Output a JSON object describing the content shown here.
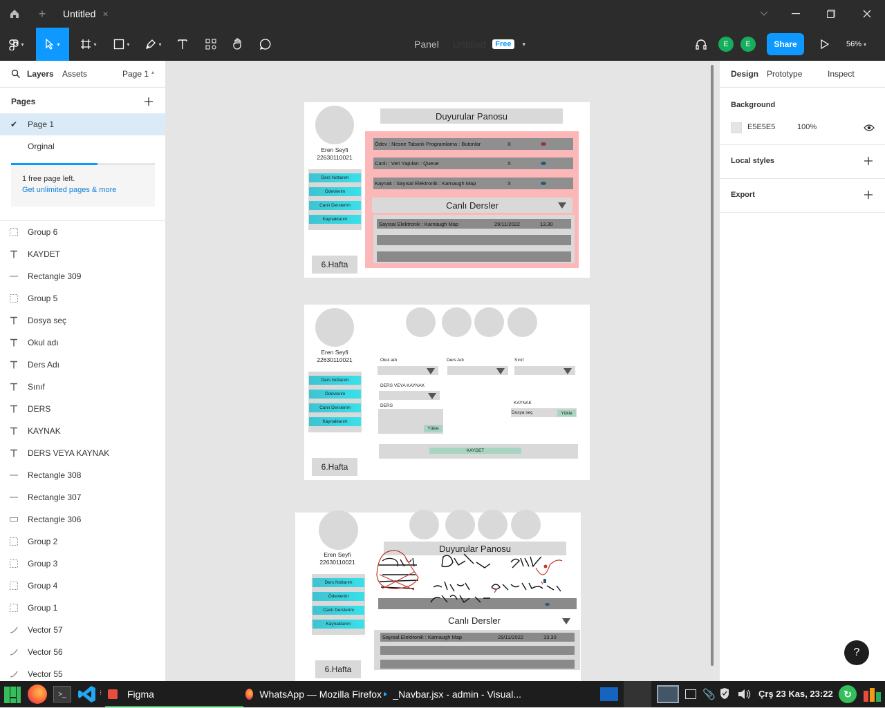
{
  "titlebar": {
    "tab_title": "Untitled",
    "close": "×",
    "new_tab": "+"
  },
  "toolbar": {
    "file_title": "Panel",
    "file_name_faded": "Untitled",
    "plan_badge": "Free",
    "avatar1": "E",
    "avatar2": "E",
    "share_label": "Share",
    "zoom": "56%"
  },
  "left_panel": {
    "tabs": {
      "layers": "Layers",
      "assets": "Assets",
      "page": "Page 1"
    },
    "pages_header": "Pages",
    "pages": [
      "Page 1",
      "Orginal"
    ],
    "free_page_progress": 0.6,
    "upsell_text": "1 free page left.",
    "upsell_link": "Get unlimited pages & more",
    "layers": [
      {
        "icon": "group-icon",
        "name": "Group 6"
      },
      {
        "icon": "text-icon",
        "name": "KAYDET"
      },
      {
        "icon": "line-icon",
        "name": "Rectangle 309"
      },
      {
        "icon": "group-icon",
        "name": "Group 5"
      },
      {
        "icon": "text-icon",
        "name": "Dosya seç"
      },
      {
        "icon": "text-icon",
        "name": "Okul adı"
      },
      {
        "icon": "text-icon",
        "name": "Ders Adı"
      },
      {
        "icon": "text-icon",
        "name": "Sınıf"
      },
      {
        "icon": "text-icon",
        "name": "DERS"
      },
      {
        "icon": "text-icon",
        "name": "KAYNAK"
      },
      {
        "icon": "text-icon",
        "name": "DERS VEYA KAYNAK"
      },
      {
        "icon": "line-icon",
        "name": "Rectangle 308"
      },
      {
        "icon": "line-icon",
        "name": "Rectangle 307"
      },
      {
        "icon": "rect-icon",
        "name": "Rectangle 306"
      },
      {
        "icon": "group-icon",
        "name": "Group 2"
      },
      {
        "icon": "group-icon",
        "name": "Group 3"
      },
      {
        "icon": "group-icon",
        "name": "Group 4"
      },
      {
        "icon": "group-icon",
        "name": "Group 1"
      },
      {
        "icon": "vector-icon",
        "name": "Vector 57"
      },
      {
        "icon": "vector-icon",
        "name": "Vector 56"
      },
      {
        "icon": "vector-icon",
        "name": "Vector 55"
      }
    ]
  },
  "right_panel": {
    "tabs": [
      "Design",
      "Prototype",
      "Inspect"
    ],
    "background_label": "Background",
    "background_hex": "E5E5E5",
    "background_opacity": "100%",
    "background_color": "#e5e5e5",
    "local_styles": "Local styles",
    "export": "Export"
  },
  "canvas": {
    "frame1": {
      "user_name": "Eren Seyfi",
      "user_id": "22630110021",
      "nav": [
        "Ders Notlarım",
        "Ödevlerim",
        "Canlı Derslerim",
        "Kaynaklarım"
      ],
      "week": "6.Hafta",
      "board_title": "Duyurular Panosu",
      "announcements": [
        {
          "text": "Ödev : Nesne Tabanlı Programlama : Butonlar",
          "x": "X"
        },
        {
          "text": "Canlı :   Veri Yapıları  :  Queue",
          "x": "X"
        },
        {
          "text": "Kaynak : Sayısal Elektronik : Karnaugh Map",
          "x": "X"
        }
      ],
      "live_title": "Canlı Dersler",
      "live_row": {
        "course": "Sayısal Elektronik : Karnaugh Map",
        "date": "29/11/2022",
        "time": "13.30"
      }
    },
    "frame2": {
      "user_name": "Eren Seyfi",
      "user_id": "22630110021",
      "nav": [
        "Ders Notlarım",
        "Ödevlerim",
        "Canlı Derslerim",
        "Kaynaklarım"
      ],
      "week": "6.Hafta",
      "okul_label": "Okul adı",
      "ders_adi_label": "Ders Adı",
      "sinif_label": "Sınıf",
      "ders_veya_kaynak": "DERS VEYA KAYNAK",
      "ders_label": "DERS",
      "kaynak_label": "KAYNAK",
      "dosya_sec": "Dosya seç",
      "yukle": "Yükle",
      "kaydet": "KAYDET"
    },
    "frame3": {
      "user_name": "Eren Seyfi",
      "user_id": "22630110021",
      "nav": [
        "Ders Notlarım",
        "Ödevlerim",
        "Canlı Derslerim",
        "Kaynaklarım"
      ],
      "week": "6.Hafta",
      "board_title": "Duyurular Panosu",
      "live_title": "Canlı Dersler",
      "live_row": {
        "course": "Sayısal Elektronik : Karnaugh Map",
        "date": "29/11/2022",
        "time": "13.30"
      }
    }
  },
  "taskbar": {
    "figma": "Figma",
    "firefox_window": "WhatsApp — Mozilla Firefox",
    "vscode_window": "_Navbar.jsx - admin - Visual...",
    "clock": "Çrş 23 Kas, 23:22"
  },
  "colors": {
    "accent_blue": "#0d99ff",
    "avatar_green": "#14ae5c",
    "pink_panel": "#fcb8b8",
    "cyan_nav": "#3fc3d1"
  }
}
